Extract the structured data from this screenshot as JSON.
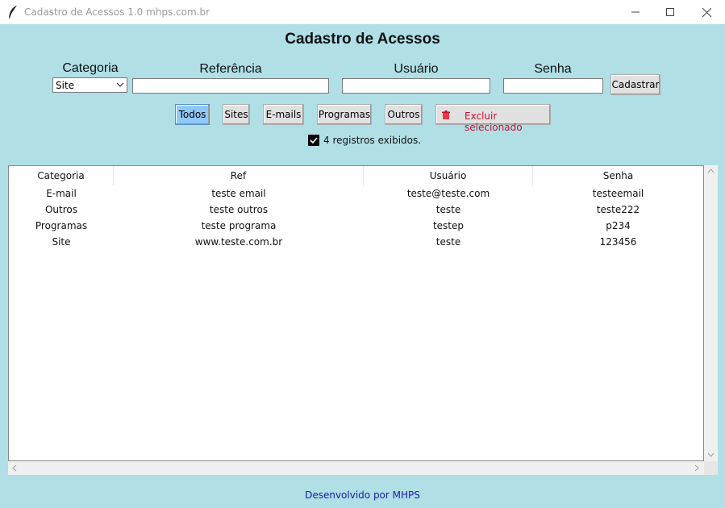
{
  "window": {
    "title": "Cadastro de Acessos 1.0 mhps.com.br",
    "icon": "feather-icon"
  },
  "heading": "Cadastro de Acessos",
  "form": {
    "categoria_label": "Categoria",
    "categoria_value": "Site",
    "referencia_label": "Referência",
    "referencia_value": "",
    "usuario_label": "Usuário",
    "usuario_value": "",
    "senha_label": "Senha",
    "senha_value": "",
    "cadastrar_label": "Cadastrar"
  },
  "filters": {
    "todos": "Todos",
    "sites": "Sites",
    "emails": "E-mails",
    "programas": "Programas",
    "outros": "Outros",
    "excluir": "Excluir selecionado",
    "active": "Todos"
  },
  "status": {
    "checked": true,
    "text": "4 registros exibidos."
  },
  "table": {
    "headers": [
      "Categoria",
      "Ref",
      "Usuário",
      "Senha"
    ],
    "rows": [
      [
        "E-mail",
        "teste email",
        "teste@teste.com",
        "testeemail"
      ],
      [
        "Outros",
        "teste outros",
        "teste",
        "teste222"
      ],
      [
        "Programas",
        "teste programa",
        "testep",
        "p234"
      ],
      [
        "Site",
        "www.teste.com.br",
        "teste",
        "123456"
      ]
    ]
  },
  "footer": "Desenvolvido por MHPS",
  "colors": {
    "background": "#b0dfe6",
    "active_button": "#8fc9f7",
    "danger_text": "#c8102e",
    "footer_link": "#1a1aa6"
  }
}
